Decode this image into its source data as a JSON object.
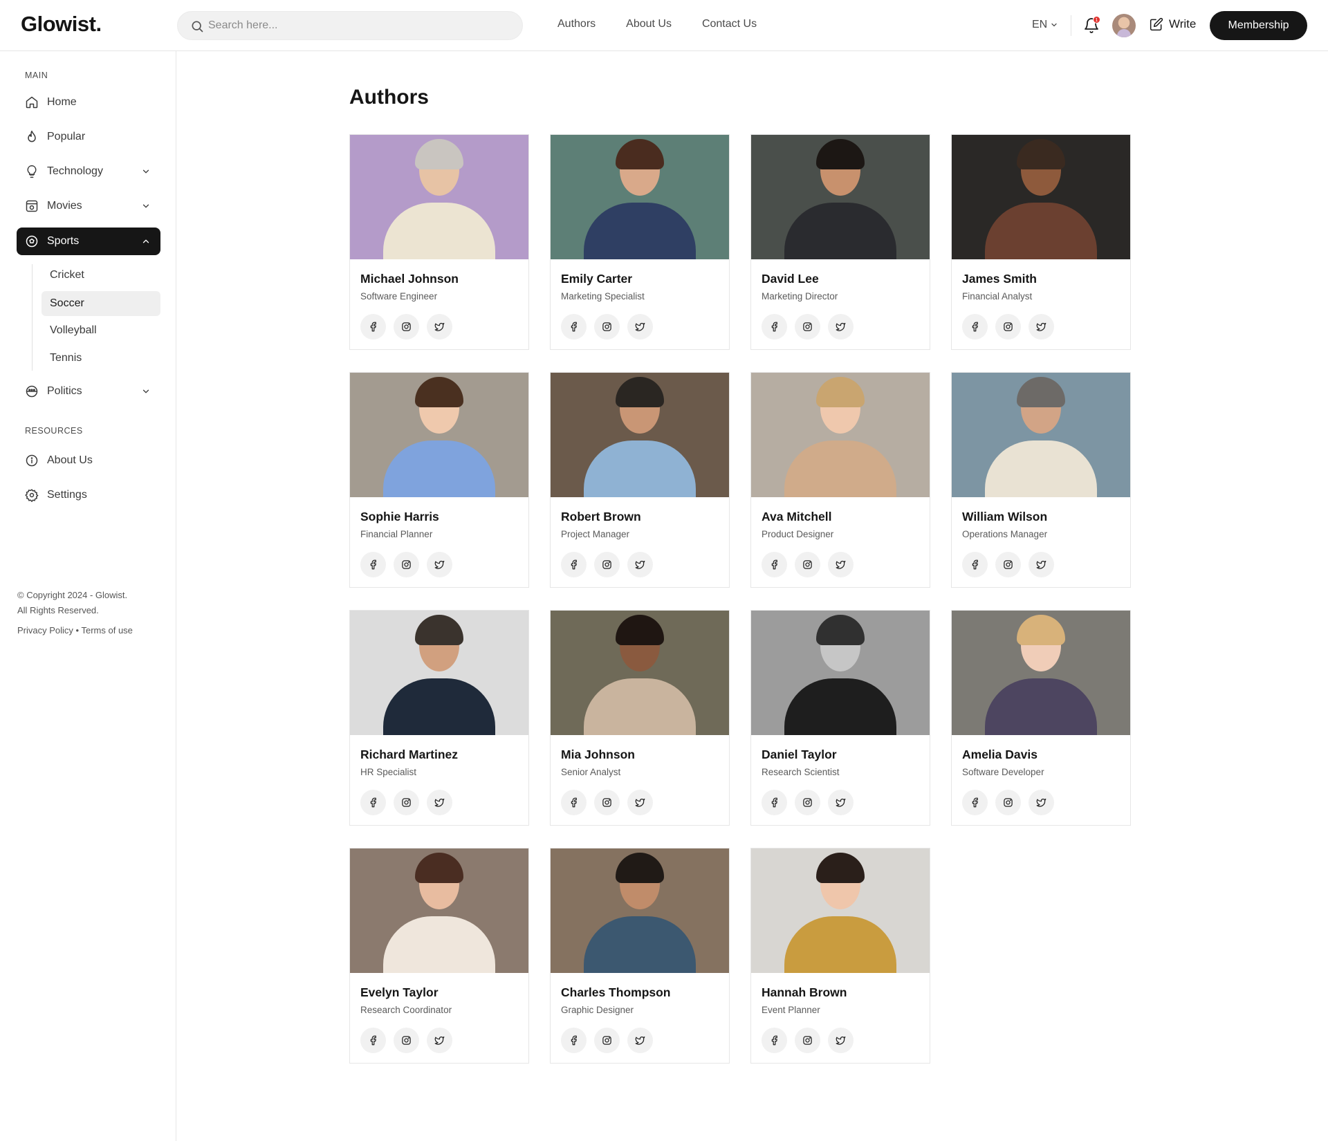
{
  "header": {
    "logo": "Glowist.",
    "search_placeholder": "Search here...",
    "nav": [
      "Authors",
      "About Us",
      "Contact Us"
    ],
    "language": "EN",
    "notification_count": "1",
    "write_label": "Write",
    "membership_label": "Membership"
  },
  "sidebar": {
    "main_title": "MAIN",
    "items": [
      {
        "label": "Home",
        "icon": "home-icon"
      },
      {
        "label": "Popular",
        "icon": "flame-icon"
      },
      {
        "label": "Technology",
        "icon": "bulb-icon"
      },
      {
        "label": "Movies",
        "icon": "film-icon"
      },
      {
        "label": "Sports",
        "icon": "soccer-ball-icon"
      }
    ],
    "sports_sub": [
      "Cricket",
      "Soccer",
      "Volleyball",
      "Tennis"
    ],
    "politics": {
      "label": "Politics",
      "icon": "politics-icon"
    },
    "resources_title": "RESOURCES",
    "resources": [
      {
        "label": "About Us",
        "icon": "info-icon"
      },
      {
        "label": "Settings",
        "icon": "gear-icon"
      }
    ],
    "copyright_line1": "© Copyright 2024 - Glowist.",
    "copyright_line2": "All Rights Reserved.",
    "privacy": "Privacy Policy",
    "terms": "Terms of use"
  },
  "main": {
    "title": "Authors",
    "authors": [
      {
        "name": "Michael Johnson",
        "role": "Software Engineer",
        "bg": "#b49bc9",
        "skin": "#e7c3a5",
        "shirt": "#ece4d2",
        "hair": "#c9c5c0"
      },
      {
        "name": "Emily Carter",
        "role": "Marketing Specialist",
        "bg": "#5d7f76",
        "skin": "#d9a98a",
        "shirt": "#2f3f63",
        "hair": "#4a2c1f"
      },
      {
        "name": "David Lee",
        "role": "Marketing Director",
        "bg": "#4a4f4b",
        "skin": "#c8916d",
        "shirt": "#2a2b2f",
        "hair": "#1c1714"
      },
      {
        "name": "James Smith",
        "role": "Financial Analyst",
        "bg": "#2a2826",
        "skin": "#8e5a3c",
        "shirt": "#6b4030",
        "hair": "#3a2a20"
      },
      {
        "name": "Sophie Harris",
        "role": "Financial Planner",
        "bg": "#a39b90",
        "skin": "#efc9ad",
        "shirt": "#7fa3dd",
        "hair": "#4a3020"
      },
      {
        "name": "Robert Brown",
        "role": "Project Manager",
        "bg": "#6b5a4b",
        "skin": "#c99675",
        "shirt": "#8fb2d3",
        "hair": "#2a2622"
      },
      {
        "name": "Ava Mitchell",
        "role": "Product Designer",
        "bg": "#b6ada2",
        "skin": "#efc8ad",
        "shirt": "#d0ab8a",
        "hair": "#c9a570"
      },
      {
        "name": "William Wilson",
        "role": "Operations Manager",
        "bg": "#7d95a3",
        "skin": "#d2a486",
        "shirt": "#e9e2d3",
        "hair": "#6d6a67"
      },
      {
        "name": "Richard Martinez",
        "role": "HR Specialist",
        "bg": "#dcdcdc",
        "skin": "#d1a07f",
        "shirt": "#1f2a3a",
        "hair": "#3a332d"
      },
      {
        "name": "Mia Johnson",
        "role": "Senior Analyst",
        "bg": "#6f6a58",
        "skin": "#8a5a3f",
        "shirt": "#c9b49e",
        "hair": "#1f1612"
      },
      {
        "name": "Daniel Taylor",
        "role": "Research Scientist",
        "bg": "#9c9c9c",
        "skin": "#c6c6c6",
        "shirt": "#1e1e1e",
        "hair": "#303030"
      },
      {
        "name": "Amelia Davis",
        "role": "Software Developer",
        "bg": "#7c7a74",
        "skin": "#f0cdb8",
        "shirt": "#4d4560",
        "hair": "#d8b27a"
      },
      {
        "name": "Evelyn Taylor",
        "role": "Research Coordinator",
        "bg": "#8b7a6e",
        "skin": "#e8bca0",
        "shirt": "#efe6dc",
        "hair": "#4a2d22"
      },
      {
        "name": "Charles Thompson",
        "role": "Graphic Designer",
        "bg": "#857260",
        "skin": "#c08c6a",
        "shirt": "#3c5870",
        "hair": "#201a16"
      },
      {
        "name": "Hannah Brown",
        "role": "Event Planner",
        "bg": "#d8d6d2",
        "skin": "#efc6ab",
        "shirt": "#c99c3f",
        "hair": "#2a1f1a"
      }
    ]
  },
  "social_icons": [
    "facebook-icon",
    "instagram-icon",
    "twitter-icon"
  ]
}
